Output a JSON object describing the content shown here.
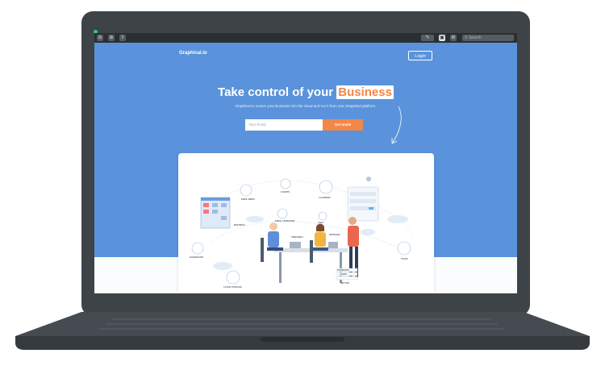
{
  "toolbar": {
    "buttons": [
      "zoom-out",
      "zoom-in",
      "share"
    ],
    "search_placeholder": "Search"
  },
  "header": {
    "brand": "Graphical.io",
    "login_label": "Login"
  },
  "hero": {
    "headline_prefix": "Take control of your",
    "headline_highlight": "Business",
    "subtitle": "Graphical.io moves your Business into the cloud and run it from one integrated platform.",
    "email_placeholder": "Your Email",
    "invite_label": "Get Invite"
  },
  "illustration": {
    "labels": {
      "email_inbox": "EMAIL INBOX",
      "clients": "CLIENTS",
      "calendar": "CALENDAR",
      "meetings": "MEETINGS",
      "email_campaigns": "EMAIL CAMPAIGNS",
      "chat": "CHAT",
      "invoicing": "INVOICING",
      "dashboard": "DASHBOARD",
      "tasks": "TASKS",
      "timesheet": "TIMESHEET",
      "estimates": "ESTIMATES",
      "leads": "LEADS",
      "sector": "SECTOR",
      "cloud_storage": "CLOUD STORAGE"
    }
  },
  "colors": {
    "hero_blue": "#5a93dc",
    "accent_orange": "#f2874a",
    "laptop_body": "#3d4347"
  }
}
